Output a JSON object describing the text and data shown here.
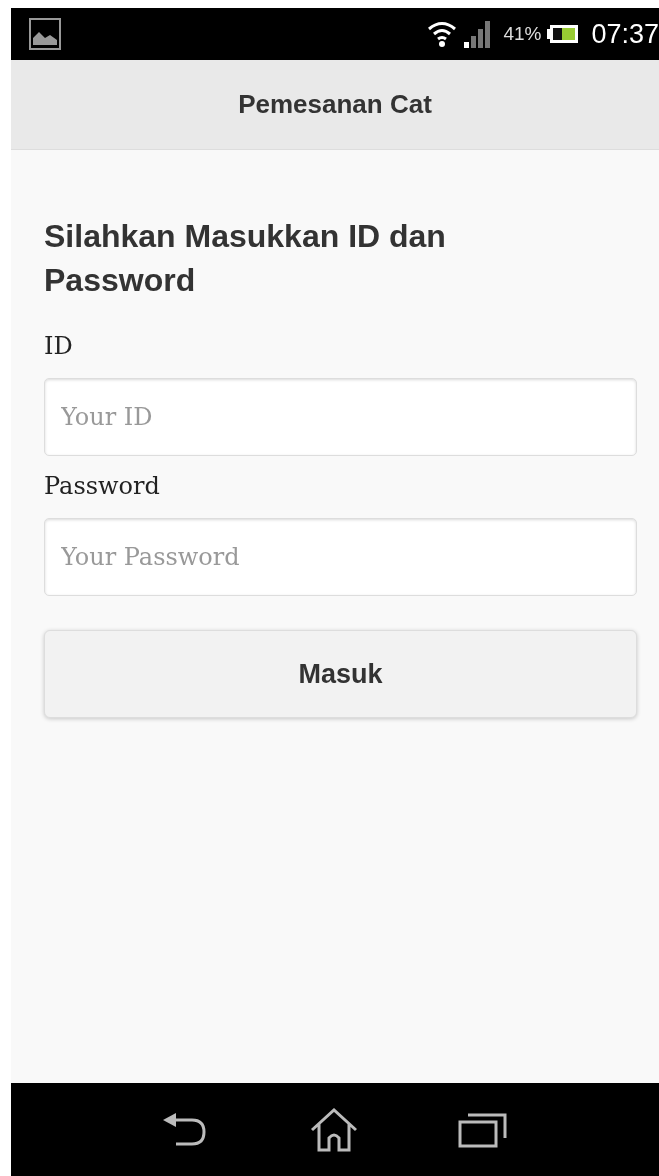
{
  "status_bar": {
    "battery_percent": "41%",
    "time": "07:37"
  },
  "header": {
    "title": "Pemesanan Cat"
  },
  "form": {
    "heading": "Silahkan Masukkan ID dan Password",
    "fields": [
      {
        "label": "ID",
        "placeholder": "Your ID"
      },
      {
        "label": "Password",
        "placeholder": "Your Password"
      }
    ],
    "submit": "Masuk"
  }
}
